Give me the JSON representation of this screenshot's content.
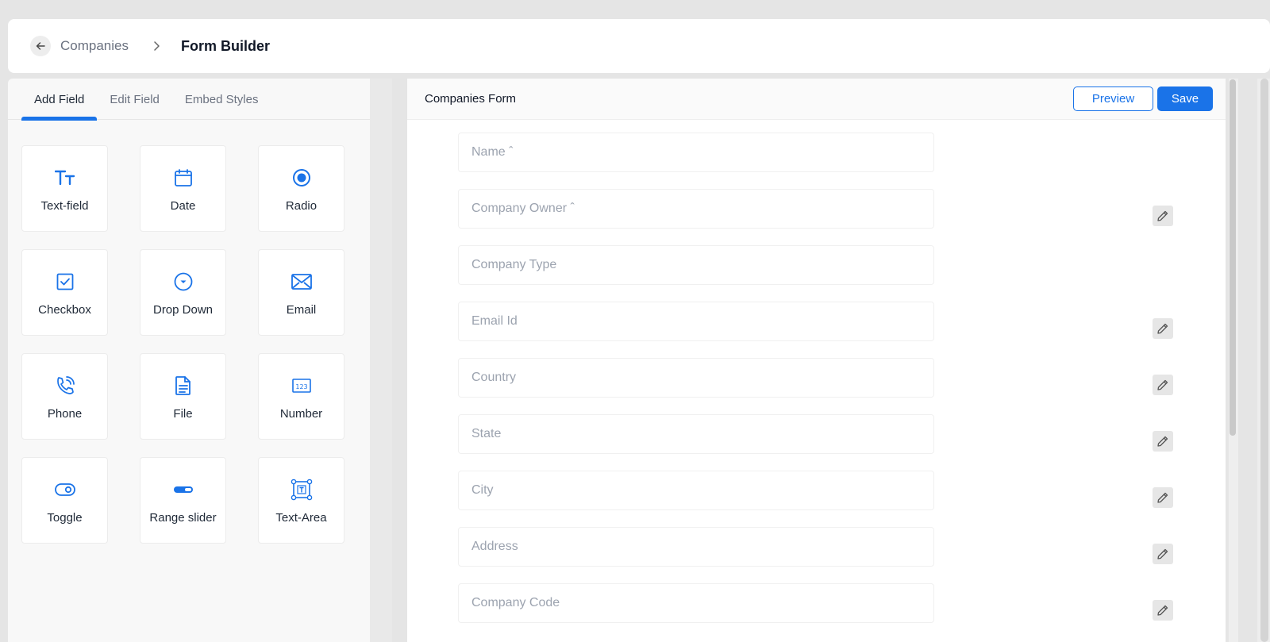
{
  "breadcrumb": {
    "parent": "Companies",
    "current": "Form Builder"
  },
  "tabs": [
    {
      "label": "Add Field",
      "active": true
    },
    {
      "label": "Edit Field",
      "active": false
    },
    {
      "label": "Embed Styles",
      "active": false
    }
  ],
  "field_types": [
    {
      "label": "Text-field",
      "icon": "text-field-icon"
    },
    {
      "label": "Date",
      "icon": "calendar-icon"
    },
    {
      "label": "Radio",
      "icon": "radio-icon"
    },
    {
      "label": "Checkbox",
      "icon": "checkbox-icon"
    },
    {
      "label": "Drop Down",
      "icon": "dropdown-icon"
    },
    {
      "label": "Email",
      "icon": "email-icon"
    },
    {
      "label": "Phone",
      "icon": "phone-icon"
    },
    {
      "label": "File",
      "icon": "file-icon"
    },
    {
      "label": "Number",
      "icon": "number-icon"
    },
    {
      "label": "Toggle",
      "icon": "toggle-icon"
    },
    {
      "label": "Range slider",
      "icon": "range-slider-icon"
    },
    {
      "label": "Text-Area",
      "icon": "text-area-icon"
    }
  ],
  "form": {
    "title": "Companies Form",
    "preview_label": "Preview",
    "save_label": "Save",
    "fields": [
      {
        "placeholder": "Name ˆ",
        "editable": false
      },
      {
        "placeholder": "Company Owner ˆ",
        "editable": true
      },
      {
        "placeholder": "Company Type",
        "editable": false
      },
      {
        "placeholder": "Email Id",
        "editable": true
      },
      {
        "placeholder": "Country",
        "editable": true
      },
      {
        "placeholder": "State",
        "editable": true
      },
      {
        "placeholder": "City",
        "editable": true
      },
      {
        "placeholder": "Address",
        "editable": true
      },
      {
        "placeholder": "Company Code",
        "editable": true
      }
    ]
  },
  "colors": {
    "accent": "#1a73e8",
    "background": "#e5e5e5"
  }
}
